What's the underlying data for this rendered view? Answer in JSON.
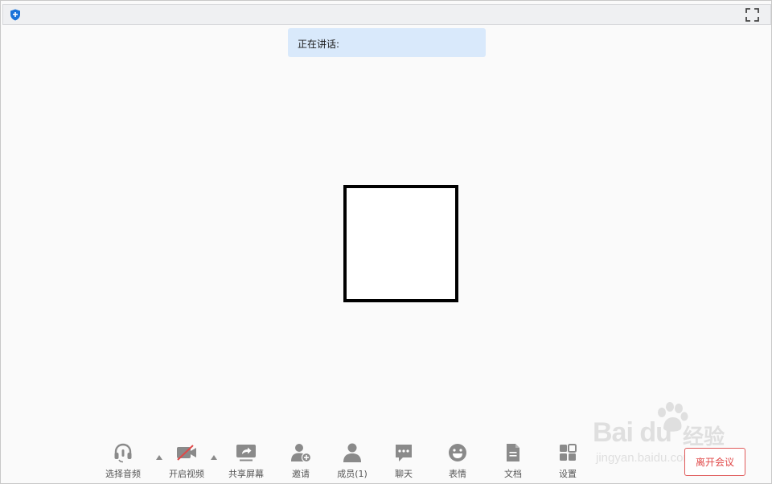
{
  "header": {
    "shield_icon": "shield-plus-icon",
    "fullscreen_icon": "fullscreen-icon"
  },
  "speaking": {
    "label": "正在讲话:"
  },
  "toolbar": {
    "items": [
      {
        "id": "audio",
        "label": "选择音频",
        "icon": "headset-icon"
      },
      {
        "id": "video",
        "label": "开启视频",
        "icon": "video-off-icon"
      },
      {
        "id": "share",
        "label": "共享屏幕",
        "icon": "share-screen-icon"
      },
      {
        "id": "invite",
        "label": "邀请",
        "icon": "add-user-icon"
      },
      {
        "id": "members",
        "label": "成员(1)",
        "icon": "user-icon"
      },
      {
        "id": "chat",
        "label": "聊天",
        "icon": "chat-icon"
      },
      {
        "id": "emoji",
        "label": "表情",
        "icon": "smile-icon"
      },
      {
        "id": "docs",
        "label": "文档",
        "icon": "document-icon"
      },
      {
        "id": "settings",
        "label": "设置",
        "icon": "grid-icon"
      }
    ],
    "leave_label": "离开会议"
  },
  "watermark": {
    "brand": "Bai du",
    "cn": "经验",
    "url": "jingyan.baidu.com"
  },
  "colors": {
    "accent": "#1a73d9",
    "leave": "#e04848",
    "icon": "#8a8a8a",
    "speaking_bg": "#d9e9fb"
  }
}
